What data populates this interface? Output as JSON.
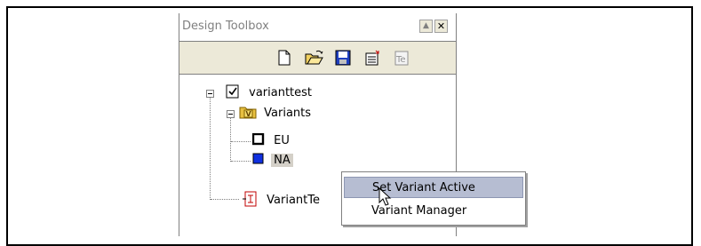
{
  "window": {
    "title": "Design Toolbox",
    "scroll_up_glyph": "▲",
    "close_glyph": "✕"
  },
  "toolbar": {
    "icons": [
      "new-document-icon",
      "open-folder-icon",
      "save-disk-icon",
      "properties-icon",
      "te-icon"
    ],
    "te_label": "Te"
  },
  "tree": {
    "root": {
      "label": "varianttest",
      "icon": "checklist-icon"
    },
    "variants_folder": {
      "label": "Variants",
      "badge": "V",
      "icon": "variant-folder-icon"
    },
    "variant_eu": {
      "label": "EU",
      "icon": "inactive-variant-icon"
    },
    "variant_na": {
      "label": "NA",
      "icon": "active-variant-icon"
    },
    "variant_test_item": {
      "label": "VariantTe",
      "icon": "variant-document-icon"
    }
  },
  "context_menu": {
    "items": [
      {
        "label": "Set Variant Active",
        "highlighted": true
      },
      {
        "label": "Variant Manager",
        "highlighted": false
      }
    ]
  },
  "colors": {
    "toolbar_bg": "#ece9d8",
    "menu_highlight": "#b6bdd2",
    "active_variant": "#1030e0",
    "folder": "#e8c040"
  }
}
